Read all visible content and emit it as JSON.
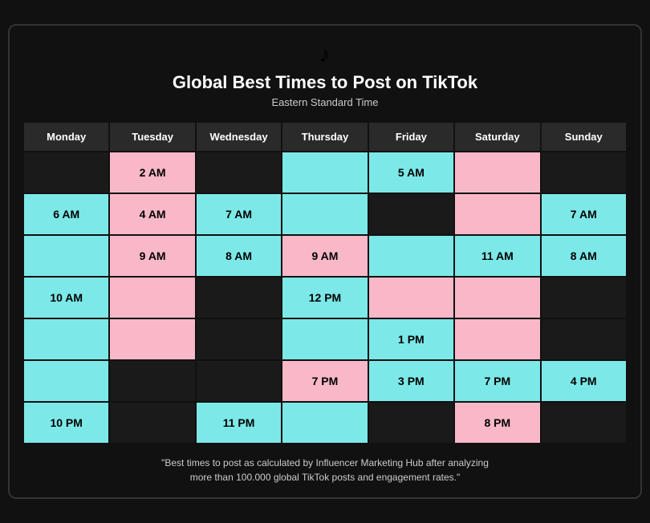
{
  "header": {
    "logo": "♪",
    "title": "Global Best Times to Post on TikTok",
    "subtitle": "Eastern Standard Time"
  },
  "columns": [
    "Monday",
    "Tuesday",
    "Wednesday",
    "Thursday",
    "Friday",
    "Saturday",
    "Sunday"
  ],
  "rows": [
    [
      {
        "text": "",
        "style": "cell-empty-dark"
      },
      {
        "text": "2 AM",
        "style": "cell-pink"
      },
      {
        "text": "",
        "style": "cell-empty-dark"
      },
      {
        "text": "",
        "style": "cell-cyan"
      },
      {
        "text": "5 AM",
        "style": "cell-cyan"
      },
      {
        "text": "",
        "style": "cell-pink"
      },
      {
        "text": "",
        "style": "cell-empty-dark"
      }
    ],
    [
      {
        "text": "6 AM",
        "style": "cell-cyan"
      },
      {
        "text": "4 AM",
        "style": "cell-pink"
      },
      {
        "text": "7 AM",
        "style": "cell-cyan"
      },
      {
        "text": "",
        "style": "cell-cyan"
      },
      {
        "text": "",
        "style": "cell-empty-dark"
      },
      {
        "text": "",
        "style": "cell-pink"
      },
      {
        "text": "7 AM",
        "style": "cell-cyan"
      }
    ],
    [
      {
        "text": "",
        "style": "cell-cyan"
      },
      {
        "text": "9 AM",
        "style": "cell-pink"
      },
      {
        "text": "8 AM",
        "style": "cell-cyan"
      },
      {
        "text": "9 AM",
        "style": "cell-pink"
      },
      {
        "text": "",
        "style": "cell-cyan"
      },
      {
        "text": "11 AM",
        "style": "cell-cyan"
      },
      {
        "text": "8 AM",
        "style": "cell-cyan"
      }
    ],
    [
      {
        "text": "10 AM",
        "style": "cell-cyan"
      },
      {
        "text": "",
        "style": "cell-pink"
      },
      {
        "text": "",
        "style": "cell-empty-dark"
      },
      {
        "text": "12 PM",
        "style": "cell-cyan"
      },
      {
        "text": "",
        "style": "cell-pink"
      },
      {
        "text": "",
        "style": "cell-pink"
      },
      {
        "text": "",
        "style": "cell-empty-dark"
      }
    ],
    [
      {
        "text": "",
        "style": "cell-cyan"
      },
      {
        "text": "",
        "style": "cell-pink"
      },
      {
        "text": "",
        "style": "cell-empty-dark"
      },
      {
        "text": "",
        "style": "cell-cyan"
      },
      {
        "text": "1 PM",
        "style": "cell-cyan"
      },
      {
        "text": "",
        "style": "cell-pink"
      },
      {
        "text": "",
        "style": "cell-empty-dark"
      }
    ],
    [
      {
        "text": "",
        "style": "cell-cyan"
      },
      {
        "text": "",
        "style": "cell-empty-dark"
      },
      {
        "text": "",
        "style": "cell-empty-dark"
      },
      {
        "text": "7 PM",
        "style": "cell-pink"
      },
      {
        "text": "3 PM",
        "style": "cell-cyan"
      },
      {
        "text": "7 PM",
        "style": "cell-cyan"
      },
      {
        "text": "4 PM",
        "style": "cell-cyan"
      }
    ],
    [
      {
        "text": "10 PM",
        "style": "cell-cyan"
      },
      {
        "text": "",
        "style": "cell-empty-dark"
      },
      {
        "text": "11 PM",
        "style": "cell-cyan"
      },
      {
        "text": "",
        "style": "cell-cyan"
      },
      {
        "text": "",
        "style": "cell-empty-dark"
      },
      {
        "text": "8 PM",
        "style": "cell-pink"
      },
      {
        "text": "",
        "style": "cell-empty-dark"
      }
    ]
  ],
  "footer": "\"Best times to post as calculated by Influencer Marketing Hub after analyzing\nmore than 100.000 global TikTok posts and engagement rates.\""
}
